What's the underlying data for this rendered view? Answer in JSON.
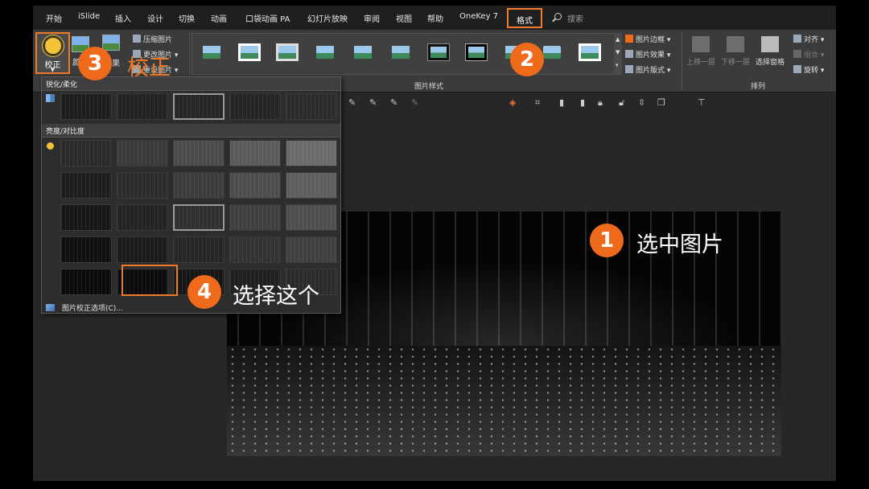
{
  "menu": {
    "items": [
      "开始",
      "iSlide",
      "插入",
      "设计",
      "切换",
      "动画",
      "口袋动画 PA",
      "幻灯片放映",
      "审阅",
      "视图",
      "帮助",
      "OneKey 7"
    ],
    "active_tab": "格式",
    "search_placeholder": "搜索"
  },
  "ribbon": {
    "correct_label": "校正",
    "color_label": "颜",
    "effects_label": "果",
    "compress_label": "压缩图片",
    "change_label": "更改图片",
    "reset_label": "重设图片",
    "styles_group_label": "图片样式",
    "border_label": "图片边框",
    "effect_label": "图片效果",
    "layout_label": "图片版式",
    "bring_forward_label": "上移一层",
    "send_backward_label": "下移一层",
    "selection_pane_label": "选择窗格",
    "align_label": "对齐",
    "group_label": "组合",
    "rotate_label": "旋转",
    "arrange_group_label": "排列"
  },
  "dropdown": {
    "sharpen_header": "锐化/柔化",
    "brightness_header": "亮度/对比度",
    "options_link": "图片校正选项(C)..."
  },
  "annotations": {
    "step1_number": "1",
    "step1_text": "选中图片",
    "step2_number": "2",
    "step3_number": "3",
    "step3_text": "校正",
    "step4_number": "4",
    "step4_text": "选择这个"
  },
  "colors": {
    "accent": "#ef7a2a",
    "badge": "#ef6a1a",
    "annotation_text": "#ffffff",
    "step3_text": "#ef7a2a"
  },
  "icons": [
    "search-icon",
    "sun-icon",
    "color-icon",
    "effects-icon",
    "compress-icon",
    "change-picture-icon",
    "reset-picture-icon",
    "border-icon",
    "effect-icon",
    "layout-icon",
    "bring-forward-icon",
    "send-backward-icon",
    "selection-pane-icon",
    "align-icon",
    "group-icon",
    "rotate-icon",
    "options-icon"
  ]
}
